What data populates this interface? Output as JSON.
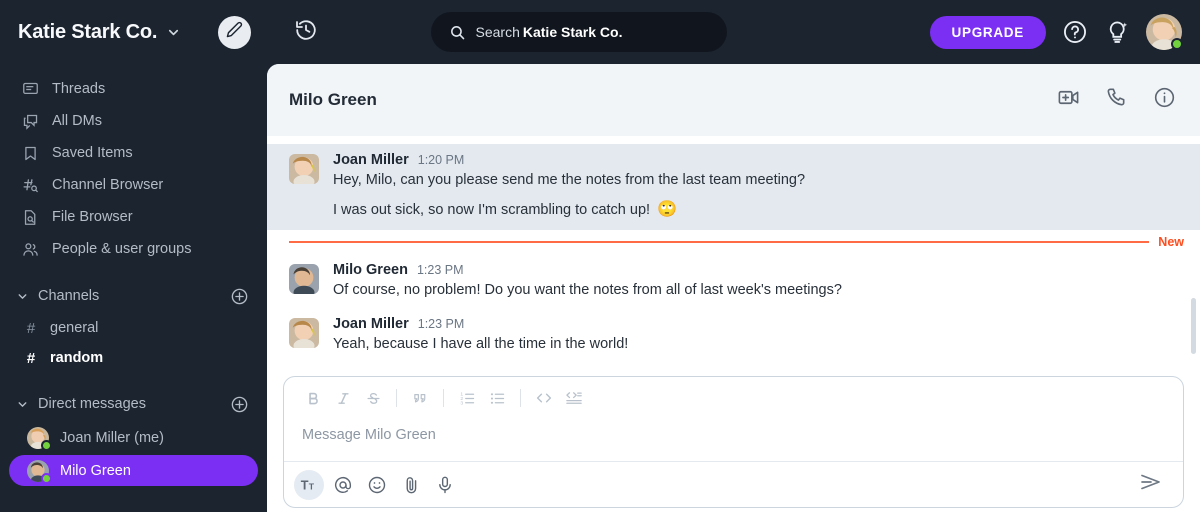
{
  "workspace": {
    "name": "Katie Stark Co.",
    "caret_icon": "chevron-down-icon",
    "compose_icon": "pencil-icon"
  },
  "sidebar": {
    "nav": [
      {
        "label": "Threads",
        "icon": "threads-icon"
      },
      {
        "label": "All DMs",
        "icon": "all-dms-icon"
      },
      {
        "label": "Saved Items",
        "icon": "bookmark-icon"
      },
      {
        "label": "Channel Browser",
        "icon": "channel-browser-icon"
      },
      {
        "label": "File Browser",
        "icon": "file-browser-icon"
      },
      {
        "label": "People & user groups",
        "icon": "people-icon"
      }
    ],
    "channels_section": {
      "title": "Channels",
      "add_icon": "plus-circle-icon",
      "collapse_icon": "chevron-down-icon",
      "items": [
        {
          "name": "general",
          "unread": false
        },
        {
          "name": "random",
          "unread": true
        }
      ]
    },
    "dm_section": {
      "title": "Direct messages",
      "add_icon": "plus-circle-icon",
      "collapse_icon": "chevron-down-icon",
      "items": [
        {
          "name": "Joan Miller (me)",
          "active": false,
          "status": "online"
        },
        {
          "name": "Milo Green",
          "active": true,
          "status": "online"
        }
      ]
    }
  },
  "topbar": {
    "history_icon": "history-clock-icon",
    "search": {
      "icon": "search-icon",
      "label": "Search",
      "scope": "Katie Stark Co."
    },
    "upgrade_label": "UPGRADE",
    "help_icon": "help-circle-icon",
    "ideas_icon": "lightbulb-sparkle-icon",
    "avatar_icon": "user-avatar",
    "status": "online"
  },
  "chat": {
    "title": "Milo Green",
    "actions": [
      {
        "icon": "video-call-icon"
      },
      {
        "icon": "phone-icon"
      },
      {
        "icon": "info-circle-icon"
      }
    ],
    "messages": [
      {
        "author": "Joan Miller",
        "time": "1:20 PM",
        "text": "Hey, Milo, can you please send me the notes from the last team meeting?",
        "highlighted": true
      },
      {
        "continuation": true,
        "text": "I was out sick, so now I'm scrambling to catch up!",
        "emoji": "🙄",
        "highlighted": true
      },
      {
        "author": "Milo Green",
        "time": "1:23 PM",
        "text": "Of course, no problem! Do you want the notes from all of last week's meetings?",
        "highlighted": false
      },
      {
        "author": "Joan Miller",
        "time": "1:23 PM",
        "text": "Yeah, because I have all the time in the world!",
        "highlighted": false
      }
    ],
    "new_divider_label": "New"
  },
  "composer": {
    "placeholder": "Message Milo Green",
    "format_buttons": [
      {
        "name": "bold",
        "label": "B"
      },
      {
        "name": "italic",
        "label": "I"
      },
      {
        "name": "strikethrough",
        "label": "S"
      },
      {
        "name": "blockquote",
        "label": "❝"
      },
      {
        "name": "ordered-list",
        "label": ""
      },
      {
        "name": "bulleted-list",
        "label": ""
      },
      {
        "name": "code",
        "label": ""
      },
      {
        "name": "code-block",
        "label": ""
      }
    ],
    "action_buttons": [
      {
        "name": "formatting",
        "icon": "text-format-icon",
        "active": true
      },
      {
        "name": "mention",
        "icon": "at-mention-icon",
        "active": false
      },
      {
        "name": "emoji",
        "icon": "emoji-smiley-icon",
        "active": false
      },
      {
        "name": "attach",
        "icon": "paperclip-icon",
        "active": false
      },
      {
        "name": "voice",
        "icon": "microphone-icon",
        "active": false
      }
    ],
    "send_icon": "send-arrow-icon"
  },
  "colors": {
    "sidebar_bg": "#1c2430",
    "accent_purple": "#7b2ff2",
    "new_orange": "#ff4d1f",
    "highlight_bg": "#e3e9ef",
    "panel_bg": "#f2f5f8",
    "online_green": "#73d13d"
  }
}
